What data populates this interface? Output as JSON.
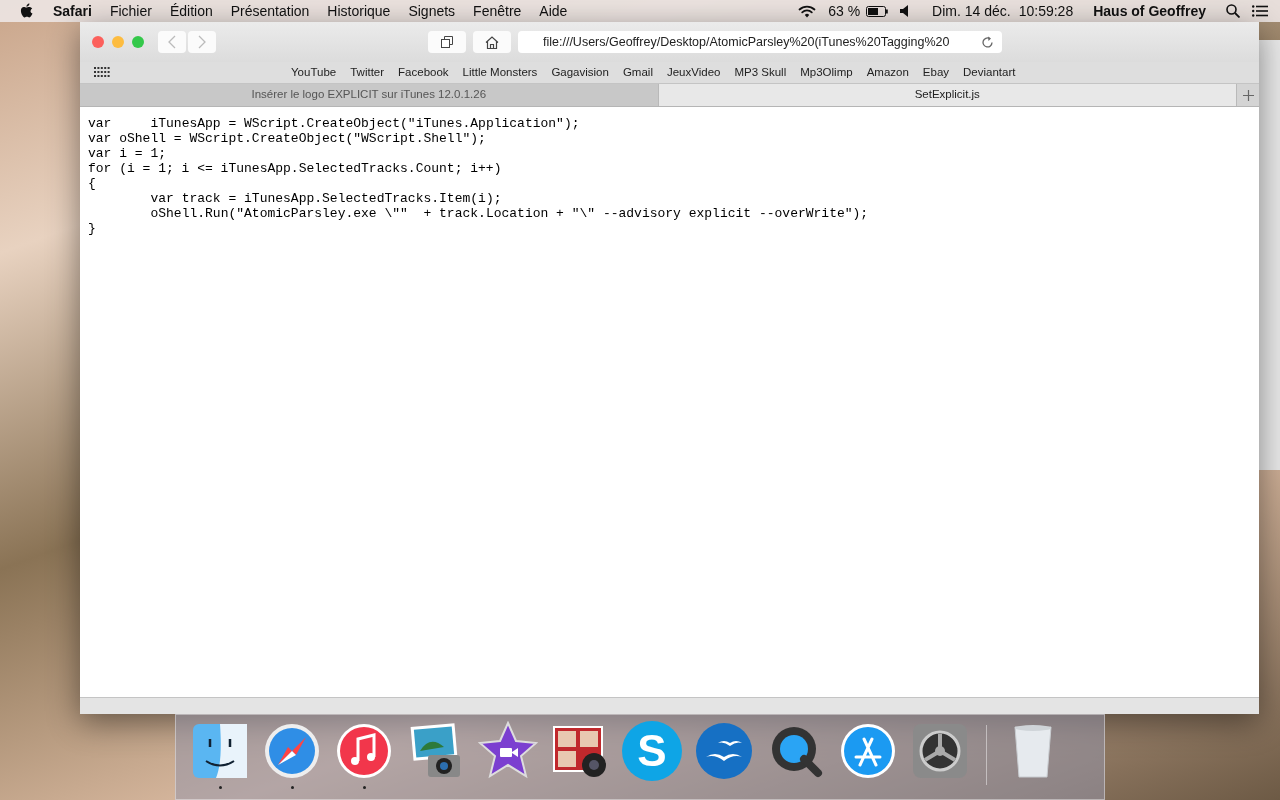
{
  "menu_bar": {
    "app_name": "Safari",
    "menus": [
      "Fichier",
      "Édition",
      "Présentation",
      "Historique",
      "Signets",
      "Fenêtre",
      "Aide"
    ],
    "battery_percent": "63 %",
    "date": "Dim. 14 déc.",
    "time": "10:59:28",
    "user": "Haus of Geoffrey"
  },
  "browser": {
    "address": "file:///Users/Geoffrey/Desktop/AtomicParsley%20(iTunes%20Tagging%20",
    "bookmarks": [
      "YouTube",
      "Twitter",
      "Facebook",
      "Little Monsters",
      "Gagavision",
      "Gmail",
      "JeuxVideo",
      "MP3 Skull",
      "Mp3Olimp",
      "Amazon",
      "Ebay",
      "Deviantart"
    ],
    "tabs": [
      {
        "label": "Insérer le logo EXPLICIT sur iTunes 12.0.1.26",
        "selected": false
      },
      {
        "label": "SetExplicit.js",
        "selected": true
      }
    ],
    "code_lines": [
      "var\tiTunesApp = WScript.CreateObject(\"iTunes.Application\");",
      "var oShell = WScript.CreateObject(\"WScript.Shell\");",
      "var i = 1;",
      "for (i = 1; i <= iTunesApp.SelectedTracks.Count; i++)",
      "{",
      "\tvar track = iTunesApp.SelectedTracks.Item(i);",
      "\toShell.Run(\"AtomicParsley.exe \\\"\"  + track.Location + \"\\\" --advisory explicit --overWrite\");",
      "}"
    ]
  },
  "dock": [
    {
      "kind": "finder",
      "running": true
    },
    {
      "kind": "safari",
      "running": true
    },
    {
      "kind": "itunes",
      "running": true
    },
    {
      "kind": "iphoto",
      "running": false
    },
    {
      "kind": "imovie",
      "running": false
    },
    {
      "kind": "photobooth",
      "running": false
    },
    {
      "kind": "skype",
      "glyph": "S",
      "running": false
    },
    {
      "kind": "openoffice",
      "running": false
    },
    {
      "kind": "quicktime",
      "running": false
    },
    {
      "kind": "appstore",
      "running": false
    },
    {
      "kind": "preferences",
      "running": false
    },
    {
      "kind": "trash",
      "running": false
    }
  ]
}
